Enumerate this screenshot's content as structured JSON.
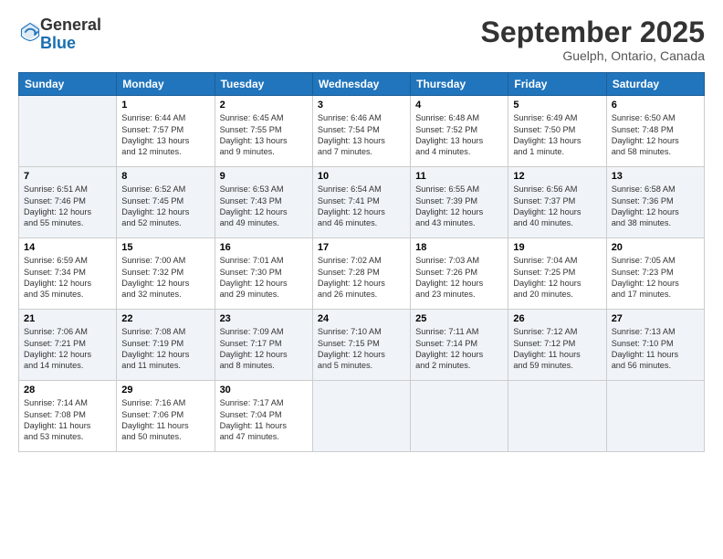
{
  "logo": {
    "general": "General",
    "blue": "Blue"
  },
  "title": "September 2025",
  "location": "Guelph, Ontario, Canada",
  "days_header": [
    "Sunday",
    "Monday",
    "Tuesday",
    "Wednesday",
    "Thursday",
    "Friday",
    "Saturday"
  ],
  "weeks": [
    [
      {
        "num": "",
        "info": ""
      },
      {
        "num": "1",
        "info": "Sunrise: 6:44 AM\nSunset: 7:57 PM\nDaylight: 13 hours\nand 12 minutes."
      },
      {
        "num": "2",
        "info": "Sunrise: 6:45 AM\nSunset: 7:55 PM\nDaylight: 13 hours\nand 9 minutes."
      },
      {
        "num": "3",
        "info": "Sunrise: 6:46 AM\nSunset: 7:54 PM\nDaylight: 13 hours\nand 7 minutes."
      },
      {
        "num": "4",
        "info": "Sunrise: 6:48 AM\nSunset: 7:52 PM\nDaylight: 13 hours\nand 4 minutes."
      },
      {
        "num": "5",
        "info": "Sunrise: 6:49 AM\nSunset: 7:50 PM\nDaylight: 13 hours\nand 1 minute."
      },
      {
        "num": "6",
        "info": "Sunrise: 6:50 AM\nSunset: 7:48 PM\nDaylight: 12 hours\nand 58 minutes."
      }
    ],
    [
      {
        "num": "7",
        "info": "Sunrise: 6:51 AM\nSunset: 7:46 PM\nDaylight: 12 hours\nand 55 minutes."
      },
      {
        "num": "8",
        "info": "Sunrise: 6:52 AM\nSunset: 7:45 PM\nDaylight: 12 hours\nand 52 minutes."
      },
      {
        "num": "9",
        "info": "Sunrise: 6:53 AM\nSunset: 7:43 PM\nDaylight: 12 hours\nand 49 minutes."
      },
      {
        "num": "10",
        "info": "Sunrise: 6:54 AM\nSunset: 7:41 PM\nDaylight: 12 hours\nand 46 minutes."
      },
      {
        "num": "11",
        "info": "Sunrise: 6:55 AM\nSunset: 7:39 PM\nDaylight: 12 hours\nand 43 minutes."
      },
      {
        "num": "12",
        "info": "Sunrise: 6:56 AM\nSunset: 7:37 PM\nDaylight: 12 hours\nand 40 minutes."
      },
      {
        "num": "13",
        "info": "Sunrise: 6:58 AM\nSunset: 7:36 PM\nDaylight: 12 hours\nand 38 minutes."
      }
    ],
    [
      {
        "num": "14",
        "info": "Sunrise: 6:59 AM\nSunset: 7:34 PM\nDaylight: 12 hours\nand 35 minutes."
      },
      {
        "num": "15",
        "info": "Sunrise: 7:00 AM\nSunset: 7:32 PM\nDaylight: 12 hours\nand 32 minutes."
      },
      {
        "num": "16",
        "info": "Sunrise: 7:01 AM\nSunset: 7:30 PM\nDaylight: 12 hours\nand 29 minutes."
      },
      {
        "num": "17",
        "info": "Sunrise: 7:02 AM\nSunset: 7:28 PM\nDaylight: 12 hours\nand 26 minutes."
      },
      {
        "num": "18",
        "info": "Sunrise: 7:03 AM\nSunset: 7:26 PM\nDaylight: 12 hours\nand 23 minutes."
      },
      {
        "num": "19",
        "info": "Sunrise: 7:04 AM\nSunset: 7:25 PM\nDaylight: 12 hours\nand 20 minutes."
      },
      {
        "num": "20",
        "info": "Sunrise: 7:05 AM\nSunset: 7:23 PM\nDaylight: 12 hours\nand 17 minutes."
      }
    ],
    [
      {
        "num": "21",
        "info": "Sunrise: 7:06 AM\nSunset: 7:21 PM\nDaylight: 12 hours\nand 14 minutes."
      },
      {
        "num": "22",
        "info": "Sunrise: 7:08 AM\nSunset: 7:19 PM\nDaylight: 12 hours\nand 11 minutes."
      },
      {
        "num": "23",
        "info": "Sunrise: 7:09 AM\nSunset: 7:17 PM\nDaylight: 12 hours\nand 8 minutes."
      },
      {
        "num": "24",
        "info": "Sunrise: 7:10 AM\nSunset: 7:15 PM\nDaylight: 12 hours\nand 5 minutes."
      },
      {
        "num": "25",
        "info": "Sunrise: 7:11 AM\nSunset: 7:14 PM\nDaylight: 12 hours\nand 2 minutes."
      },
      {
        "num": "26",
        "info": "Sunrise: 7:12 AM\nSunset: 7:12 PM\nDaylight: 11 hours\nand 59 minutes."
      },
      {
        "num": "27",
        "info": "Sunrise: 7:13 AM\nSunset: 7:10 PM\nDaylight: 11 hours\nand 56 minutes."
      }
    ],
    [
      {
        "num": "28",
        "info": "Sunrise: 7:14 AM\nSunset: 7:08 PM\nDaylight: 11 hours\nand 53 minutes."
      },
      {
        "num": "29",
        "info": "Sunrise: 7:16 AM\nSunset: 7:06 PM\nDaylight: 11 hours\nand 50 minutes."
      },
      {
        "num": "30",
        "info": "Sunrise: 7:17 AM\nSunset: 7:04 PM\nDaylight: 11 hours\nand 47 minutes."
      },
      {
        "num": "",
        "info": ""
      },
      {
        "num": "",
        "info": ""
      },
      {
        "num": "",
        "info": ""
      },
      {
        "num": "",
        "info": ""
      }
    ]
  ]
}
